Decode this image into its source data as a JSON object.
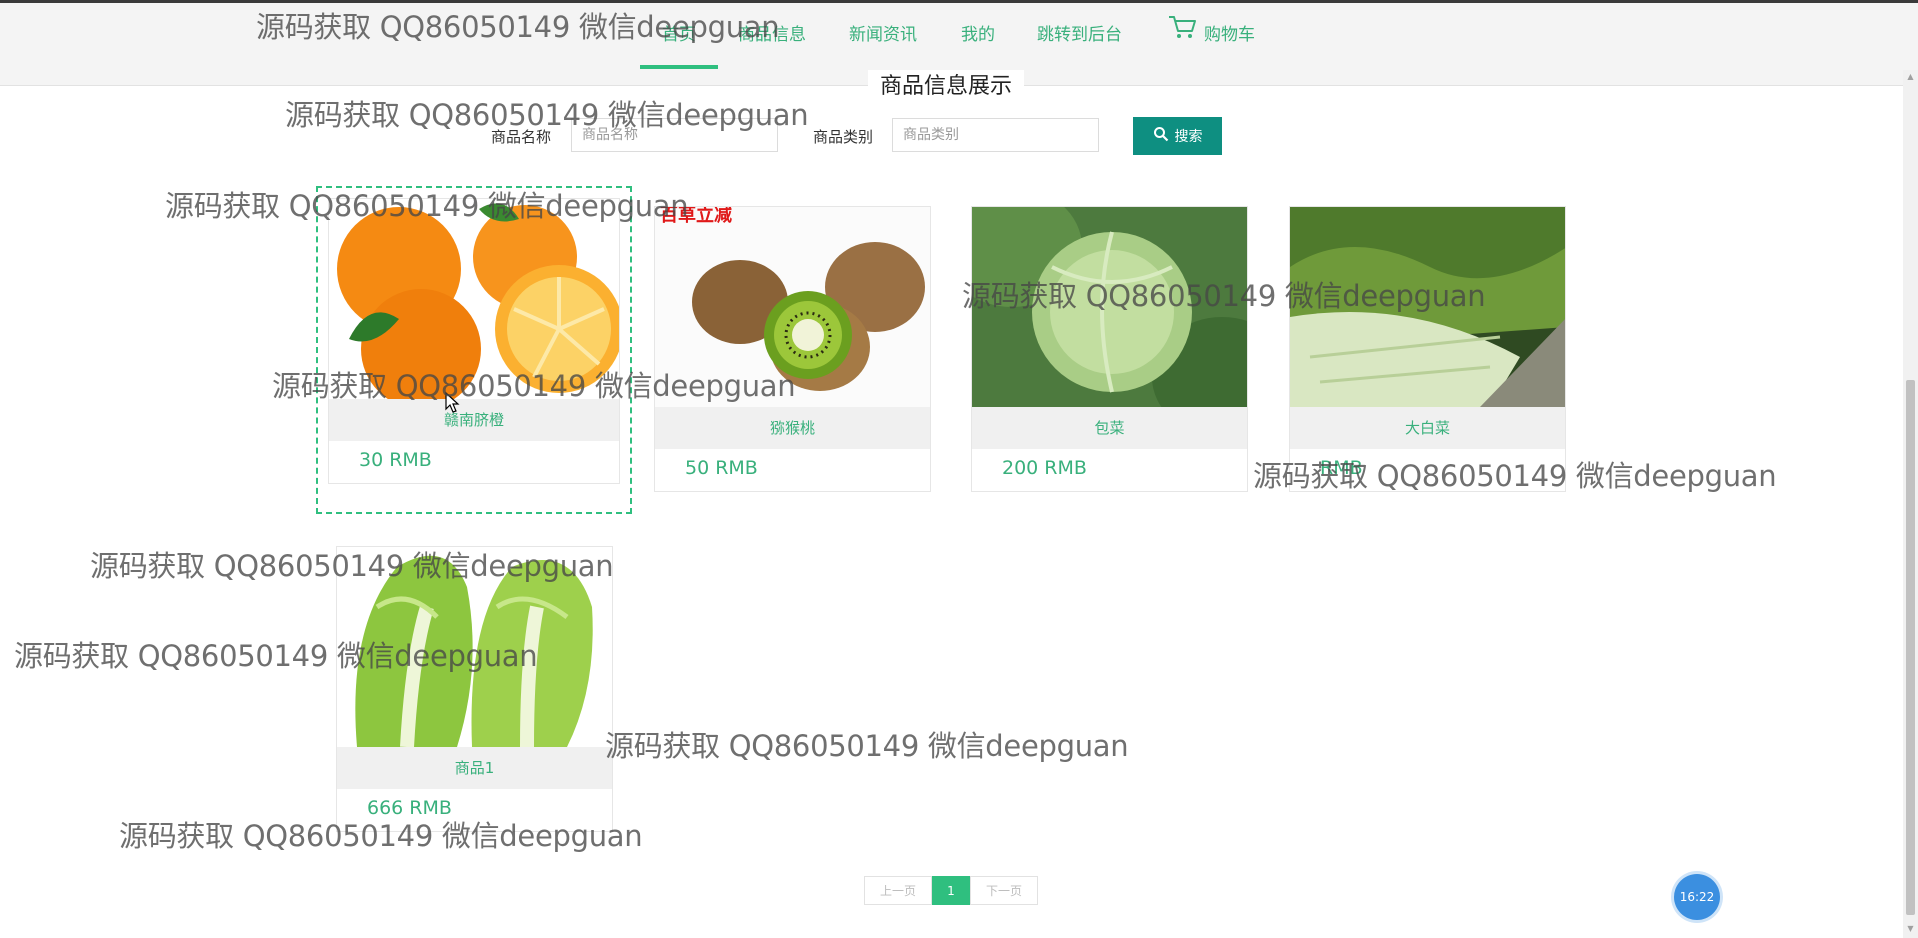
{
  "nav": {
    "items": [
      {
        "label": "首页",
        "active": true
      },
      {
        "label": "商品信息"
      },
      {
        "label": "新闻资讯"
      },
      {
        "label": "我的"
      },
      {
        "label": "跳转到后台"
      }
    ],
    "cart_label": "购物车",
    "cart_icon": "shopping-cart-icon"
  },
  "section": {
    "title": "商品信息展示"
  },
  "search": {
    "name_label": "商品名称",
    "name_placeholder": "商品名称",
    "category_label": "商品类别",
    "category_placeholder": "商品类别",
    "button_label": "搜索",
    "button_icon": "search-icon",
    "button_color": "#0e8f81"
  },
  "products": [
    {
      "name": "赣南脐橙",
      "price": "30 RMB",
      "image": "oranges"
    },
    {
      "name": "猕猴桃",
      "price": "50 RMB",
      "image": "kiwi"
    },
    {
      "name": "包菜",
      "price": "200 RMB",
      "image": "cabbage"
    },
    {
      "name": "大白菜",
      "price": "RMB",
      "image": "napa-cabbage"
    },
    {
      "name": "商品1",
      "price": "666 RMB",
      "image": "lettuce"
    }
  ],
  "pagination": {
    "prev": "上一页",
    "current": "1",
    "next": "下一页"
  },
  "clock": {
    "time": "16:22"
  },
  "watermark": {
    "text": "源码获取 QQ86050149 微信deepguan"
  },
  "colors": {
    "accent": "#2fbf7f",
    "text_green": "#39b07c"
  }
}
